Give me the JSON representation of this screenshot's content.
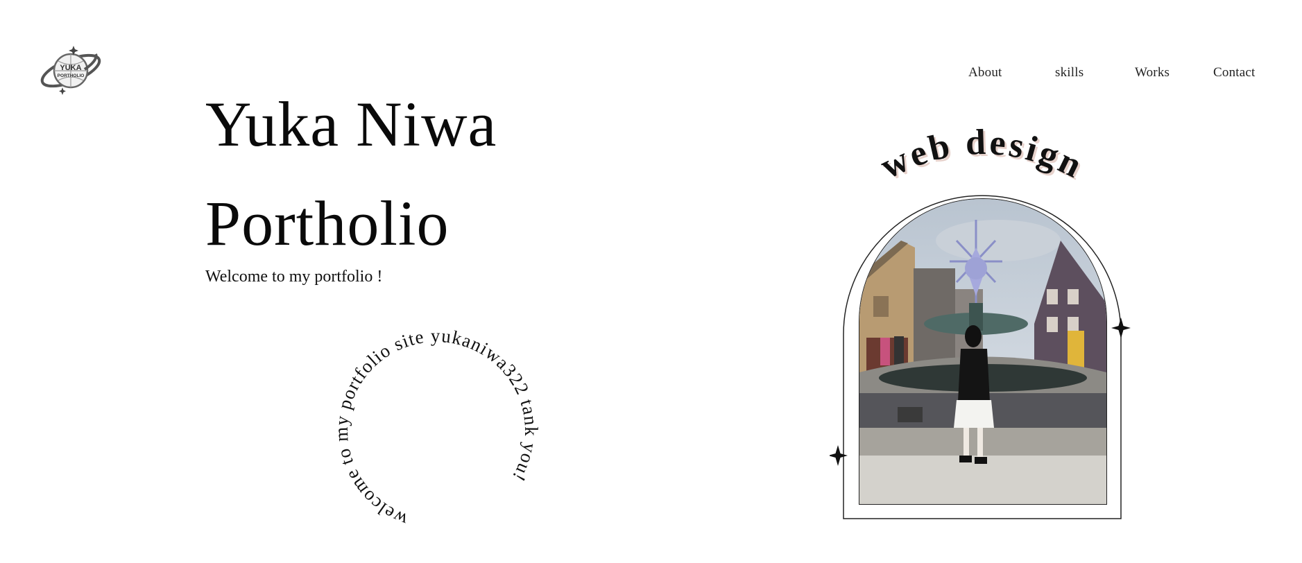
{
  "logo": {
    "text_top": "YUKA",
    "text_bottom": "PORTHOLIO",
    "icon": "globe-orbit-logo"
  },
  "nav": {
    "items": [
      {
        "label": "About"
      },
      {
        "label": "skills"
      },
      {
        "label": "Works"
      },
      {
        "label": "Contact"
      }
    ]
  },
  "hero": {
    "title_line1": "Yuka Niwa",
    "title_line2": "Portholio",
    "subtitle": "Welcome to my portfolio !"
  },
  "circle_text": "welcome to my portfolio site yukaniwa322 tank you!",
  "arch": {
    "heading": "web design",
    "sparkle_icon": "four-point-star-icon"
  },
  "colors": {
    "text": "#111111",
    "background": "#ffffff",
    "heading_shadow": "#e7d2cc"
  }
}
